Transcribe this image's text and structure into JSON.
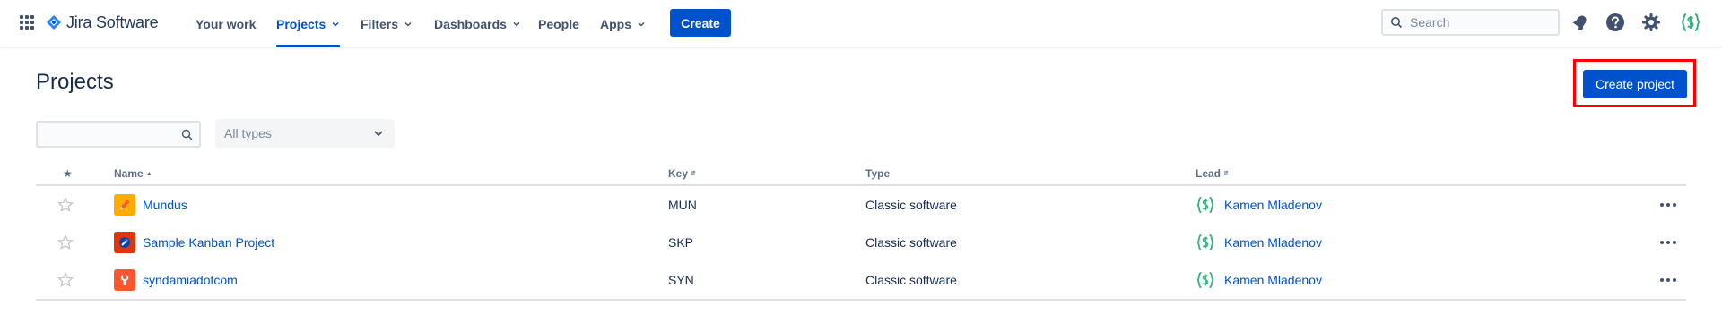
{
  "app": {
    "brand": "Jira Software",
    "nav": [
      {
        "label": "Your work"
      },
      {
        "label": "Projects"
      },
      {
        "label": "Filters"
      },
      {
        "label": "Dashboards"
      },
      {
        "label": "People"
      },
      {
        "label": "Apps"
      }
    ],
    "create_label": "Create",
    "search_placeholder": "Search"
  },
  "page": {
    "title": "Projects",
    "create_project_label": "Create project",
    "type_filter_value": "All types"
  },
  "table": {
    "headers": {
      "star": "★",
      "name": "Name",
      "key": "Key",
      "type": "Type",
      "lead": "Lead"
    },
    "rows": [
      {
        "name": "Mundus",
        "key": "MUN",
        "type": "Classic software",
        "lead": "Kamen Mladenov",
        "icon": "pencil-project-icon"
      },
      {
        "name": "Sample Kanban Project",
        "key": "SKP",
        "type": "Classic software",
        "lead": "Kamen Mladenov",
        "icon": "rocket-project-icon"
      },
      {
        "name": "syndamiadotcom",
        "key": "SYN",
        "type": "Classic software",
        "lead": "Kamen Mladenov",
        "icon": "wrench-project-icon"
      }
    ]
  },
  "colors": {
    "primary": "#0052cc",
    "highlight": "#ff0000",
    "avatar_green": "#36b37e"
  }
}
